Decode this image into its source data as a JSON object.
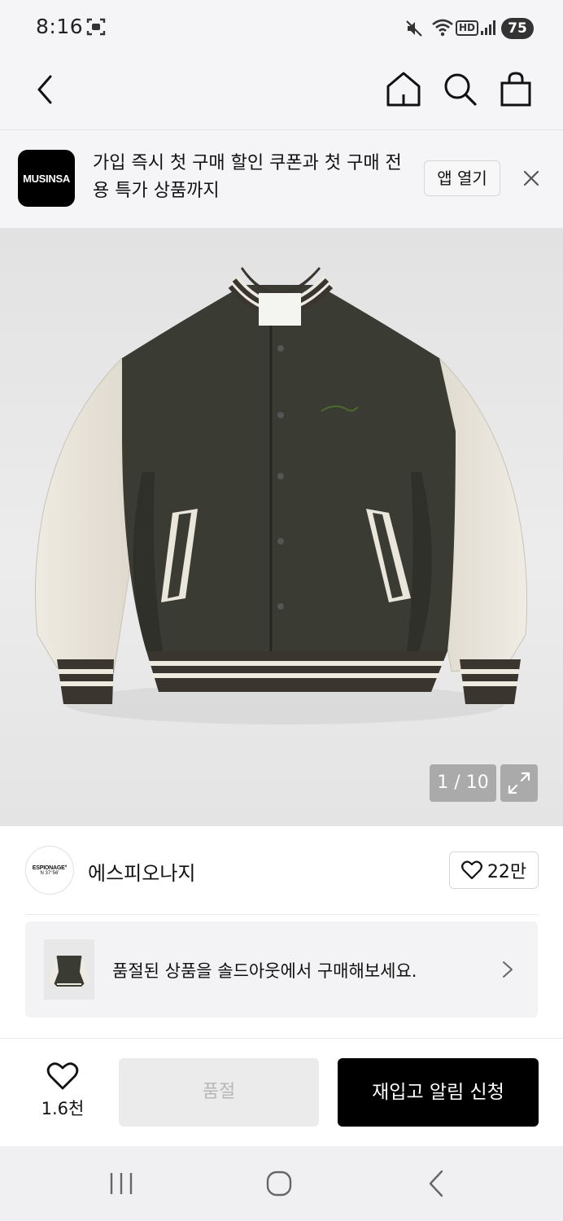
{
  "status_bar": {
    "time": "8:16",
    "network_badge": "HD",
    "battery": "75"
  },
  "top_nav": {
    "icons": [
      "back-icon",
      "home-icon",
      "search-icon",
      "shopping-bag-icon"
    ]
  },
  "app_banner": {
    "logo_text": "MUSINSA",
    "message": "가입 즉시 첫 구매 할인 쿠폰과 첫 구매 전용 특가 상품까지",
    "open_app_label": "앱 열기"
  },
  "gallery": {
    "page_indicator": "1 / 10",
    "current_page": 1,
    "total_pages": 10
  },
  "brand": {
    "logo_text_line1": "ESPIONAGE°",
    "logo_text_line2": "N 37°56'",
    "name": "에스피오나지",
    "like_count": "22만"
  },
  "soldout_notice": {
    "message": "품절된 상품을 솔드아웃에서 구매해보세요."
  },
  "action_bar": {
    "wish_count": "1.6천",
    "soldout_label": "품절",
    "restock_label": "재입고 알림 신청"
  },
  "colors": {
    "primary_button": "#000000",
    "disabled_button": "#ebebeb",
    "background_gray": "#f5f5f7"
  }
}
